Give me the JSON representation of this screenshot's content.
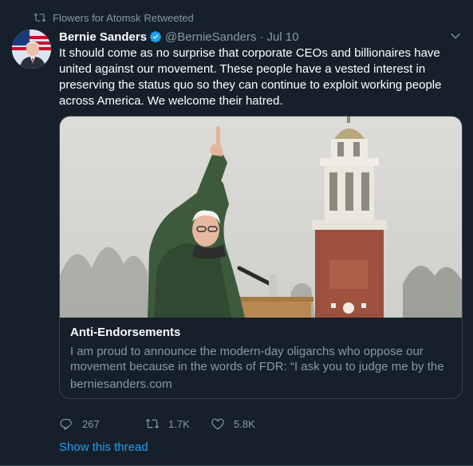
{
  "retweet": {
    "retweeter": "Flowers for Atomsk",
    "label": "Retweeted"
  },
  "tweet": {
    "name": "Bernie Sanders",
    "handle": "@BernieSanders",
    "separator": "·",
    "date": "Jul 10",
    "text": "It should come as no surprise that corporate CEOs and billionaires have united against our movement. These people have a vested interest in preserving the status quo so they can continue to exploit working people across America. We welcome their hatred."
  },
  "card": {
    "title": "Anti-Endorsements",
    "description": "I am proud to announce the modern-day oligarchs who oppose our movement because in the words of FDR: “I ask you to judge me by the ...",
    "domain": "berniesanders.com"
  },
  "actions": {
    "replies": "267",
    "retweets": "1.7K",
    "likes": "5.8K"
  },
  "thread_link": "Show this thread",
  "colors": {
    "background": "#15202b",
    "secondary_text": "#8899a6",
    "accent": "#1da1f2",
    "border": "#38444d"
  },
  "icons": [
    "retweet-icon",
    "verified-badge-icon",
    "chevron-down-icon",
    "reply-icon",
    "like-icon"
  ]
}
